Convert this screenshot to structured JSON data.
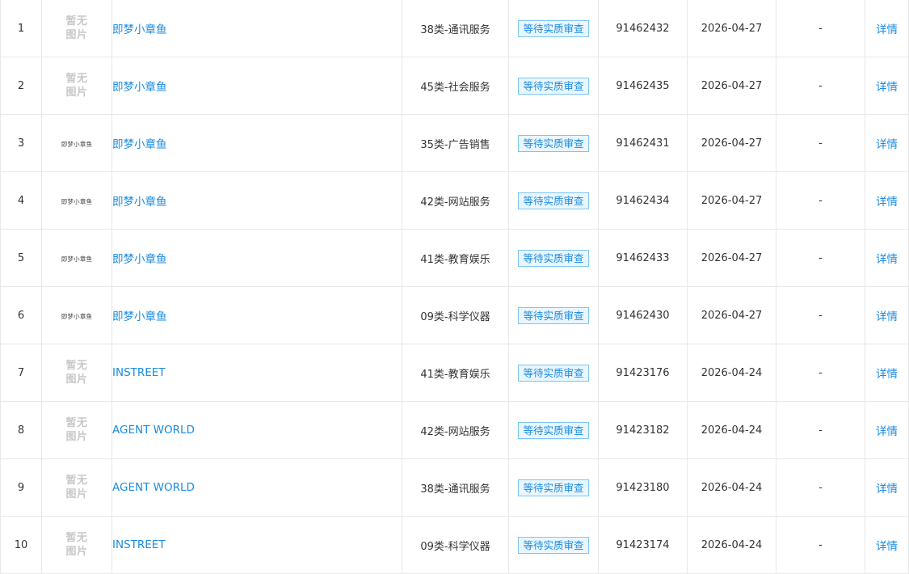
{
  "rows": [
    {
      "index": "1",
      "image": {
        "type": "none",
        "text_line1": "暂无",
        "text_line2": "图片"
      },
      "name": "即梦小章鱼",
      "class": "38类-通讯服务",
      "status": "等待实质审查",
      "reg_no": "91462432",
      "date": "2026-04-27",
      "extra": "-",
      "action": "详情"
    },
    {
      "index": "2",
      "image": {
        "type": "none",
        "text_line1": "暂无",
        "text_line2": "图片"
      },
      "name": "即梦小章鱼",
      "class": "45类-社会服务",
      "status": "等待实质审查",
      "reg_no": "91462435",
      "date": "2026-04-27",
      "extra": "-",
      "action": "详情"
    },
    {
      "index": "3",
      "image": {
        "type": "logo",
        "text": "即梦小章鱼"
      },
      "name": "即梦小章鱼",
      "class": "35类-广告销售",
      "status": "等待实质审查",
      "reg_no": "91462431",
      "date": "2026-04-27",
      "extra": "-",
      "action": "详情"
    },
    {
      "index": "4",
      "image": {
        "type": "logo",
        "text": "即梦小章鱼"
      },
      "name": "即梦小章鱼",
      "class": "42类-网站服务",
      "status": "等待实质审查",
      "reg_no": "91462434",
      "date": "2026-04-27",
      "extra": "-",
      "action": "详情"
    },
    {
      "index": "5",
      "image": {
        "type": "logo",
        "text": "即梦小章鱼"
      },
      "name": "即梦小章鱼",
      "class": "41类-教育娱乐",
      "status": "等待实质审查",
      "reg_no": "91462433",
      "date": "2026-04-27",
      "extra": "-",
      "action": "详情"
    },
    {
      "index": "6",
      "image": {
        "type": "logo",
        "text": "即梦小章鱼"
      },
      "name": "即梦小章鱼",
      "class": "09类-科学仪器",
      "status": "等待实质审查",
      "reg_no": "91462430",
      "date": "2026-04-27",
      "extra": "-",
      "action": "详情"
    },
    {
      "index": "7",
      "image": {
        "type": "none",
        "text_line1": "暂无",
        "text_line2": "图片"
      },
      "name": "INSTREET",
      "class": "41类-教育娱乐",
      "status": "等待实质审查",
      "reg_no": "91423176",
      "date": "2026-04-24",
      "extra": "-",
      "action": "详情"
    },
    {
      "index": "8",
      "image": {
        "type": "none",
        "text_line1": "暂无",
        "text_line2": "图片"
      },
      "name": "AGENT WORLD",
      "class": "42类-网站服务",
      "status": "等待实质审查",
      "reg_no": "91423182",
      "date": "2026-04-24",
      "extra": "-",
      "action": "详情"
    },
    {
      "index": "9",
      "image": {
        "type": "none",
        "text_line1": "暂无",
        "text_line2": "图片"
      },
      "name": "AGENT WORLD",
      "class": "38类-通讯服务",
      "status": "等待实质审查",
      "reg_no": "91423180",
      "date": "2026-04-24",
      "extra": "-",
      "action": "详情"
    },
    {
      "index": "10",
      "image": {
        "type": "none",
        "text_line1": "暂无",
        "text_line2": "图片"
      },
      "name": "INSTREET",
      "class": "09类-科学仪器",
      "status": "等待实质审查",
      "reg_no": "91423174",
      "date": "2026-04-24",
      "extra": "-",
      "action": "详情"
    }
  ],
  "colors": {
    "link": "#1a8be0",
    "badge_border": "#7cc6f2",
    "badge_bg": "#eaf6fe",
    "grid": "#e8e8e8",
    "placeholder": "#c8c8c8",
    "text": "#333333"
  }
}
